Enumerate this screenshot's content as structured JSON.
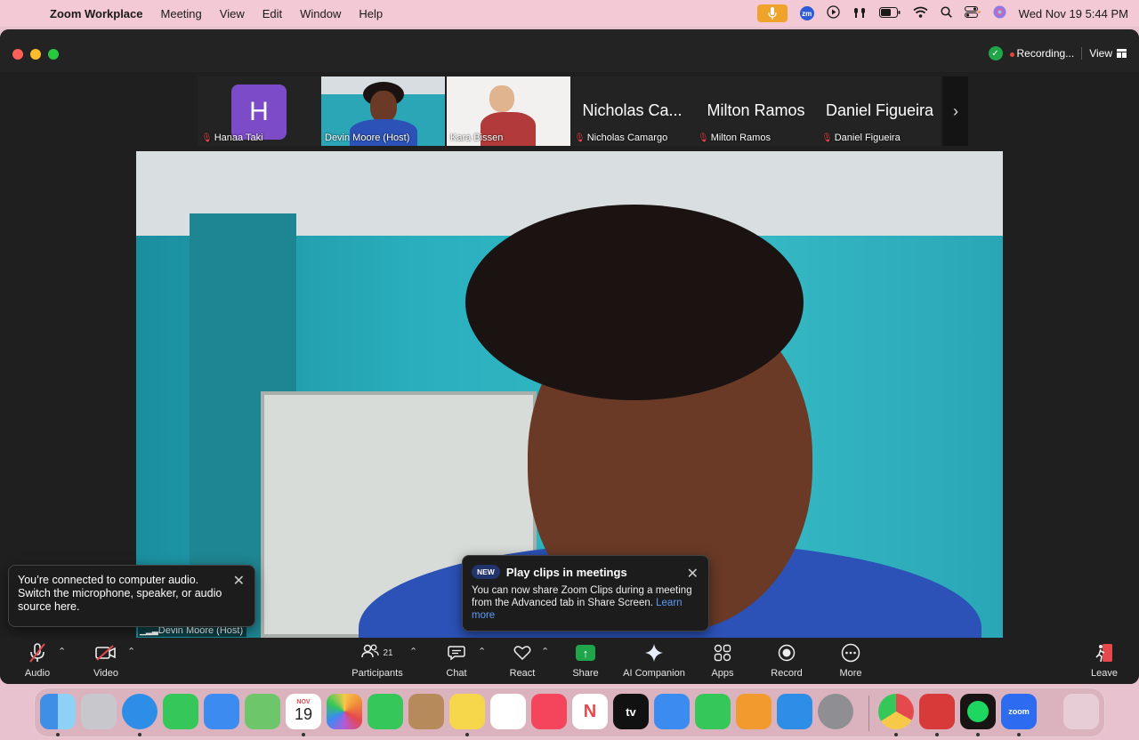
{
  "menubar": {
    "app_name": "Zoom Workplace",
    "menus": [
      "Meeting",
      "View",
      "Edit",
      "Window",
      "Help"
    ],
    "zoom_status_icon": "zm",
    "clock": "Wed Nov 19  5:44 PM"
  },
  "titlebar": {
    "recording_label": "Recording...",
    "view_label": "View"
  },
  "strip": {
    "tiles": [
      {
        "avatar_letter": "H",
        "name": "Hanaa Taki",
        "muted": true
      },
      {
        "name": "Devin Moore (Host)",
        "muted": false,
        "active": true
      },
      {
        "name": "Kara Bissen",
        "muted": false
      },
      {
        "big": "Nicholas Ca...",
        "name": "Nicholas Camargo",
        "muted": true
      },
      {
        "big": "Milton Ramos",
        "name": "Milton Ramos",
        "muted": true
      },
      {
        "big": "Daniel Figueira",
        "name": "Daniel Figueira",
        "muted": true
      }
    ],
    "next_icon": "chevron-right-icon"
  },
  "main_video": {
    "name_label": "Devin Moore (Host)"
  },
  "audio_popup": {
    "text": "You’re connected to computer audio. Switch the microphone, speaker, or audio source here."
  },
  "clips_popup": {
    "badge": "NEW",
    "title": "Play clips in meetings",
    "body": "You can now share Zoom Clips during a meeting from the Advanced tab in Share Screen.",
    "link": "Learn more"
  },
  "controls": {
    "audio": "Audio",
    "video": "Video",
    "participants": "Participants",
    "participants_count": "21",
    "chat": "Chat",
    "react": "React",
    "share": "Share",
    "ai": "AI Companion",
    "apps": "Apps",
    "record": "Record",
    "more": "More",
    "leave": "Leave"
  },
  "dock": {
    "calendar_month": "NOV",
    "calendar_day": "19",
    "tv_label": "tv",
    "zoom_label": "zoom",
    "apps": [
      "Finder",
      "Launchpad",
      "Safari",
      "Messages",
      "Mail",
      "Maps",
      "Calendar",
      "Photos",
      "FaceTime",
      "Contacts",
      "Notes",
      "Reminders",
      "Music",
      "News",
      "TV",
      "Keynote",
      "Numbers",
      "Pages",
      "App Store",
      "System Settings",
      "Chrome",
      "Photo Booth",
      "Spotify",
      "Zoom",
      "Trash"
    ]
  },
  "colors": {
    "accent_green": "#35c759",
    "muted_red": "#e5484d",
    "share_green": "#1fa64a",
    "link_blue": "#5b9cf5"
  }
}
